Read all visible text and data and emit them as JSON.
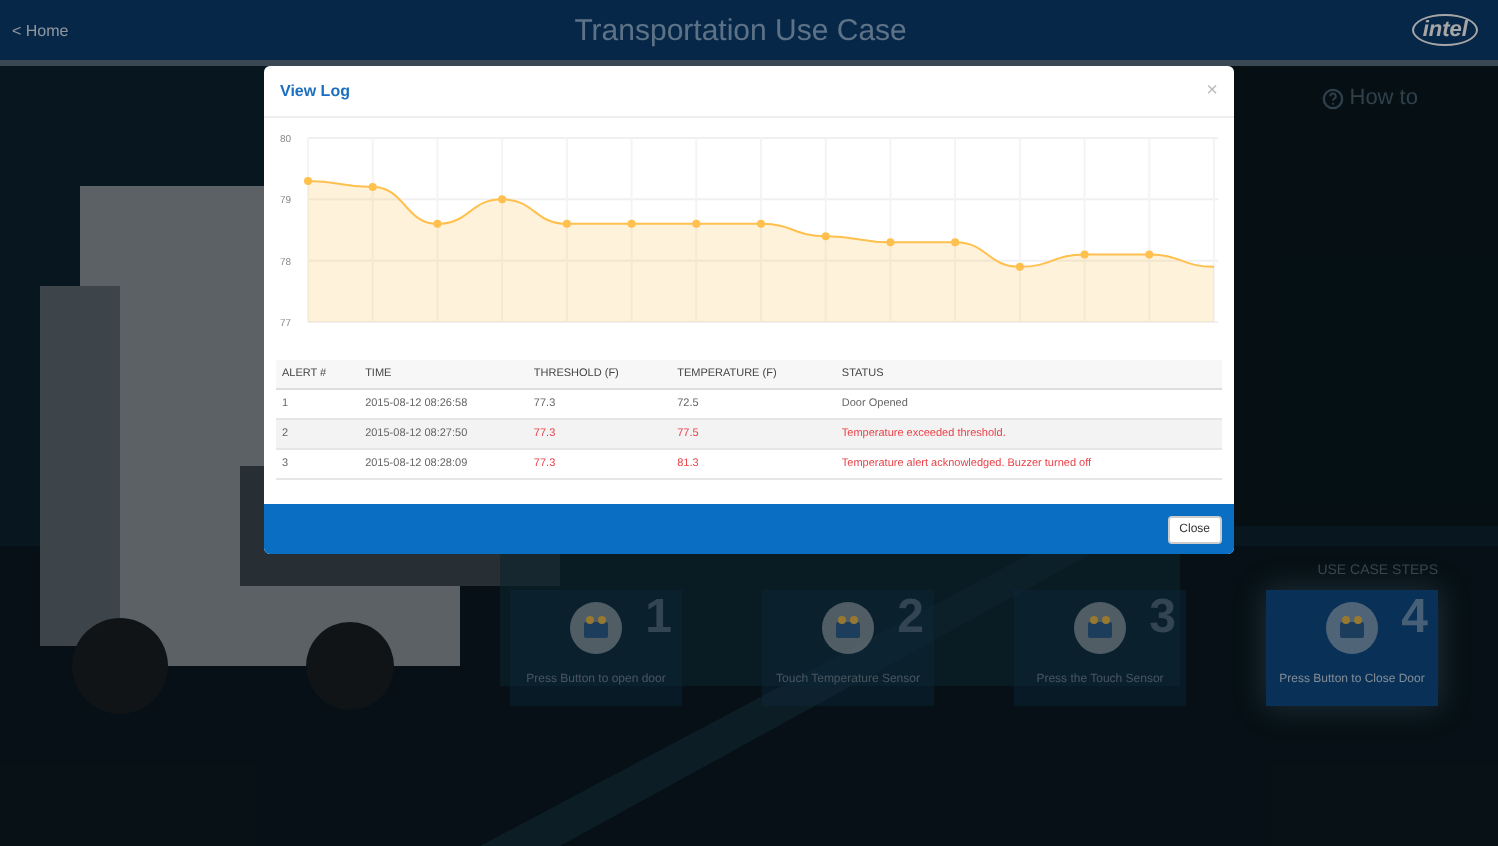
{
  "header": {
    "back_link": "< Home",
    "title": "Transportation Use Case",
    "logo": "intel"
  },
  "help": {
    "label": "How to"
  },
  "steps": {
    "title": "USE CASE STEPS",
    "items": [
      {
        "number": "1",
        "label": "Press Button to open door",
        "selected": false
      },
      {
        "number": "2",
        "label": "Touch Temperature Sensor",
        "selected": false
      },
      {
        "number": "3",
        "label": "Press the Touch Sensor",
        "selected": false
      },
      {
        "number": "4",
        "label": "Press Button to Close Door",
        "selected": true
      }
    ]
  },
  "modal": {
    "title": "View Log",
    "close_icon": "×",
    "chart_data": {
      "type": "area",
      "grid": true,
      "ylim": [
        77,
        80
      ],
      "yticks": [
        77,
        78,
        79,
        80
      ],
      "series": [
        {
          "color": "#ffc04d",
          "values": [
            79.3,
            79.2,
            78.6,
            79.0,
            78.6,
            78.6,
            78.6,
            78.6,
            78.4,
            78.3,
            78.3,
            77.9,
            78.1,
            78.1,
            77.9
          ]
        }
      ]
    },
    "table": {
      "columns": [
        "ALERT #",
        "TIME",
        "THRESHOLD (F)",
        "TEMPERATURE (F)",
        "STATUS"
      ],
      "rows": [
        {
          "cells": [
            "1",
            "2015-08-12 08:26:58",
            "77.3",
            "72.5",
            "Door Opened"
          ],
          "alert": false
        },
        {
          "cells": [
            "2",
            "2015-08-12 08:27:50",
            "77.3",
            "77.5",
            "Temperature exceeded threshold."
          ],
          "alert": true
        },
        {
          "cells": [
            "3",
            "2015-08-12 08:28:09",
            "77.3",
            "81.3",
            "Temperature alert acknowledged. Buzzer turned off"
          ],
          "alert": true
        }
      ]
    },
    "buttons": [
      "Close"
    ]
  }
}
